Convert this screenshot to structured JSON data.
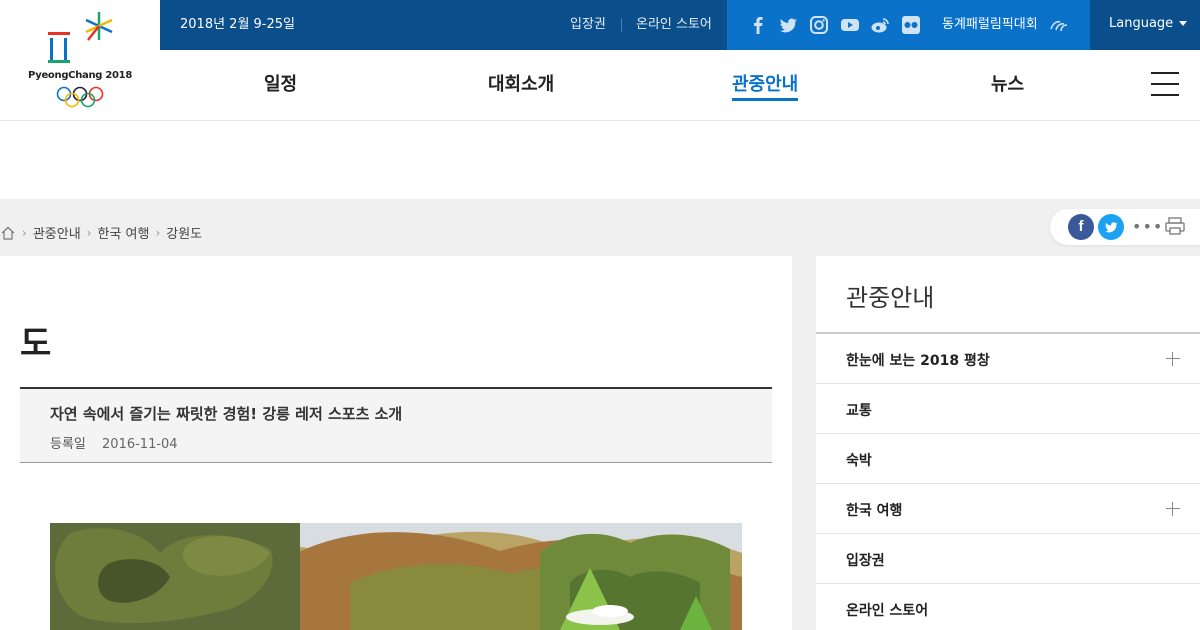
{
  "brand": {
    "logo_text": "PyeongChang 2018"
  },
  "topbar": {
    "date": "2018년 2월 9-25일",
    "links": [
      "입장권",
      "온라인 스토어"
    ],
    "social_icons": [
      "facebook-icon",
      "twitter-icon",
      "instagram-icon",
      "youtube-icon",
      "weibo-icon",
      "flickr-icon"
    ],
    "paralympics": "동계패럴림픽대회",
    "language": "Language"
  },
  "nav": {
    "items": [
      "일정",
      "대회소개",
      "관중안내",
      "뉴스"
    ],
    "active": "관중안내"
  },
  "breadcrumb": {
    "items": [
      "관중안내",
      "한국 여행",
      "강원도"
    ]
  },
  "share": {
    "facebook": "f"
  },
  "main": {
    "title": "도",
    "article": {
      "title": "자연 속에서 즐기는 짜릿한 경험! 강릉 레저 스포츠 소개",
      "date_label": "등록일",
      "date": "2016-11-04"
    }
  },
  "sidebar": {
    "title": "관중안내",
    "items": [
      {
        "label": "한눈에 보는 2018 평창",
        "expandable": true
      },
      {
        "label": "교통",
        "expandable": false
      },
      {
        "label": "숙박",
        "expandable": false
      },
      {
        "label": "한국 여행",
        "expandable": true
      },
      {
        "label": "입장권",
        "expandable": false
      },
      {
        "label": "온라인 스토어",
        "expandable": false
      }
    ]
  },
  "colors": {
    "topbar": "#0a4f8c",
    "social_bar": "#0a72c8",
    "accent": "#0a72c8",
    "facebook": "#3b5998",
    "twitter": "#1da1f2"
  }
}
